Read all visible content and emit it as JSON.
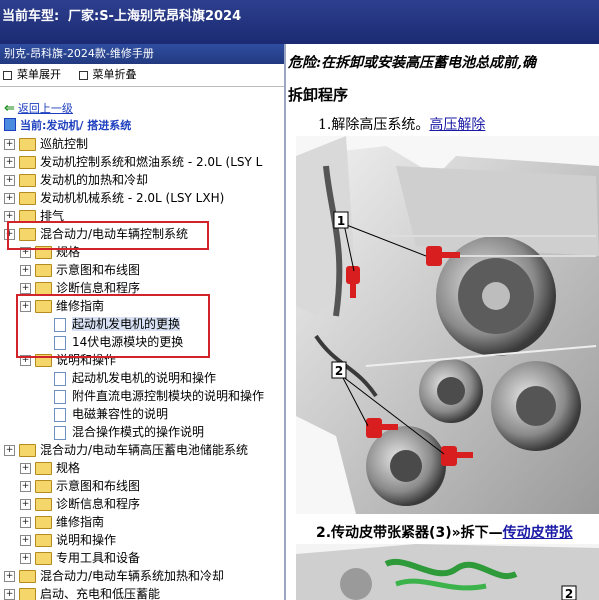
{
  "topbar": {
    "model_label": "当前车型:",
    "model_value": "厂家:S-上海别克昂科旗2024"
  },
  "left": {
    "title": "别克-昂科旗-2024款-维修手册",
    "expand_label": "菜单展开",
    "collapse_label": "菜单折叠",
    "back_label": "返回上一级",
    "current_label": "当前:发动机/ 搭进系统",
    "tree": [
      {
        "label": "巡航控制",
        "level": 0,
        "type": "folder"
      },
      {
        "label": "发动机控制系统和燃油系统 - 2.0L (LSY L",
        "level": 0,
        "type": "folder"
      },
      {
        "label": "发动机的加热和冷却",
        "level": 0,
        "type": "folder"
      },
      {
        "label": "发动机机械系统 - 2.0L (LSY LXH)",
        "level": 0,
        "type": "folder"
      },
      {
        "label": "排气",
        "level": 0,
        "type": "folder"
      },
      {
        "label": "混合动力/电动车辆控制系统",
        "level": 0,
        "type": "folder"
      },
      {
        "label": "规格",
        "level": 1,
        "type": "folder"
      },
      {
        "label": "示意图和布线图",
        "level": 1,
        "type": "folder"
      },
      {
        "label": "诊断信息和程序",
        "level": 1,
        "type": "folder"
      },
      {
        "label": "维修指南",
        "level": 1,
        "type": "folder"
      },
      {
        "label": "起动机发电机的更换",
        "level": 2,
        "type": "doc",
        "selected": true
      },
      {
        "label": "14伏电源模块的更换",
        "level": 2,
        "type": "doc"
      },
      {
        "label": "说明和操作",
        "level": 1,
        "type": "folder"
      },
      {
        "label": "起动机发电机的说明和操作",
        "level": 2,
        "type": "doc"
      },
      {
        "label": "附件直流电源控制模块的说明和操作",
        "level": 2,
        "type": "doc"
      },
      {
        "label": "电磁兼容性的说明",
        "level": 2,
        "type": "doc"
      },
      {
        "label": "混合操作模式的操作说明",
        "level": 2,
        "type": "doc"
      },
      {
        "label": "混合动力/电动车辆高压蓄电池储能系统",
        "level": 0,
        "type": "folder"
      },
      {
        "label": "规格",
        "level": 1,
        "type": "folder"
      },
      {
        "label": "示意图和布线图",
        "level": 1,
        "type": "folder"
      },
      {
        "label": "诊断信息和程序",
        "level": 1,
        "type": "folder"
      },
      {
        "label": "维修指南",
        "level": 1,
        "type": "folder"
      },
      {
        "label": "说明和操作",
        "level": 1,
        "type": "folder"
      },
      {
        "label": "专用工具和设备",
        "level": 1,
        "type": "folder"
      },
      {
        "label": "混合动力/电动车辆系统加热和冷却",
        "level": 0,
        "type": "folder"
      },
      {
        "label": "启动、充电和低压蓄能",
        "level": 0,
        "type": "folder"
      }
    ]
  },
  "content": {
    "warning": "危险:在拆卸或安装高压蓄电池总成前,确",
    "procedure_title": "拆卸程序",
    "step1_text": "1.解除高压系统。",
    "step1_link": "高压解除",
    "step2_text": "2.传动皮带张紧器(3)»拆下—",
    "step2_link": "传动皮带张",
    "callouts": [
      "1",
      "2",
      "2"
    ]
  }
}
